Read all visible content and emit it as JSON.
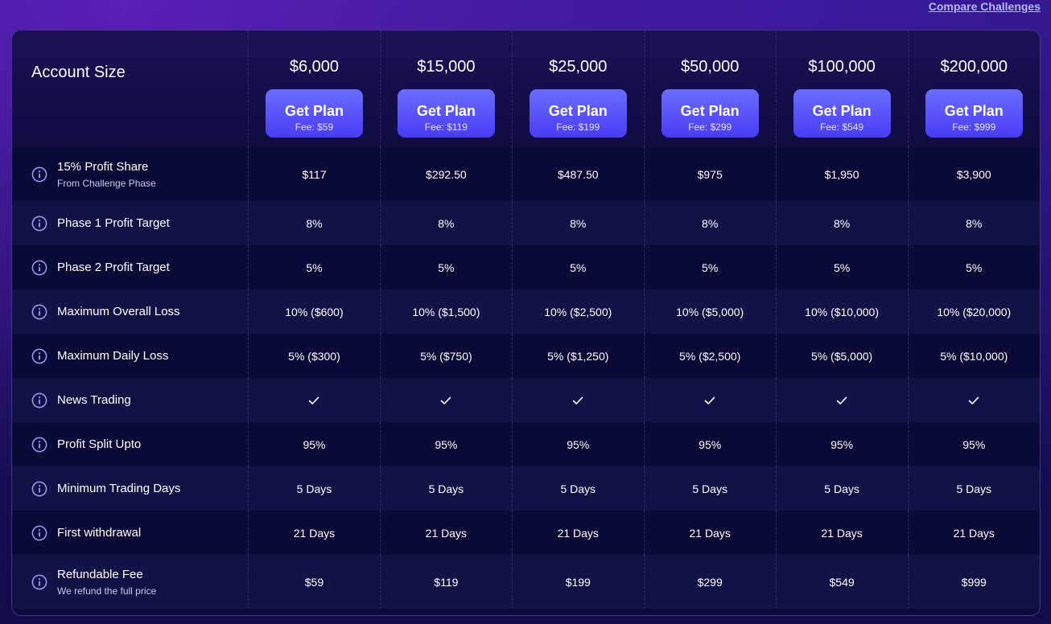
{
  "header": {
    "compare_link": "Compare Challenges"
  },
  "table": {
    "account_size_label": "Account Size",
    "plans": [
      {
        "size": "$6,000",
        "button": "Get Plan",
        "fee": "Fee: $59"
      },
      {
        "size": "$15,000",
        "button": "Get Plan",
        "fee": "Fee: $119"
      },
      {
        "size": "$25,000",
        "button": "Get Plan",
        "fee": "Fee: $199"
      },
      {
        "size": "$50,000",
        "button": "Get Plan",
        "fee": "Fee: $299"
      },
      {
        "size": "$100,000",
        "button": "Get Plan",
        "fee": "Fee: $549"
      },
      {
        "size": "$200,000",
        "button": "Get Plan",
        "fee": "Fee: $999"
      }
    ],
    "rows": [
      {
        "label": "15% Profit Share",
        "sub": "From Challenge Phase",
        "values": [
          "$117",
          "$292.50",
          "$487.50",
          "$975",
          "$1,950",
          "$3,900"
        ]
      },
      {
        "label": "Phase 1 Profit Target",
        "values": [
          "8%",
          "8%",
          "8%",
          "8%",
          "8%",
          "8%"
        ]
      },
      {
        "label": "Phase 2 Profit Target",
        "values": [
          "5%",
          "5%",
          "5%",
          "5%",
          "5%",
          "5%"
        ]
      },
      {
        "label": "Maximum Overall Loss",
        "values": [
          "10% ($600)",
          "10% ($1,500)",
          "10% ($2,500)",
          "10% ($5,000)",
          "10% ($10,000)",
          "10% ($20,000)"
        ]
      },
      {
        "label": "Maximum Daily Loss",
        "values": [
          "5% ($300)",
          "5% ($750)",
          "5% ($1,250)",
          "5% ($2,500)",
          "5% ($5,000)",
          "5% ($10,000)"
        ]
      },
      {
        "label": "News Trading",
        "check": true,
        "values": [
          true,
          true,
          true,
          true,
          true,
          true
        ]
      },
      {
        "label": "Profit Split Upto",
        "values": [
          "95%",
          "95%",
          "95%",
          "95%",
          "95%",
          "95%"
        ]
      },
      {
        "label": "Minimum Trading Days",
        "values": [
          "5 Days",
          "5 Days",
          "5 Days",
          "5 Days",
          "5 Days",
          "5 Days"
        ]
      },
      {
        "label": "First withdrawal",
        "values": [
          "21 Days",
          "21 Days",
          "21 Days",
          "21 Days",
          "21 Days",
          "21 Days"
        ]
      },
      {
        "label": "Refundable Fee",
        "sub": "We refund the full price",
        "values": [
          "$59",
          "$119",
          "$199",
          "$299",
          "$549",
          "$999"
        ]
      }
    ]
  },
  "icons": {
    "info": "info-icon",
    "check": "check-icon"
  },
  "colors": {
    "accent": "#5b55ff",
    "background": "#0d0a3b",
    "link": "#b5b8ff"
  }
}
